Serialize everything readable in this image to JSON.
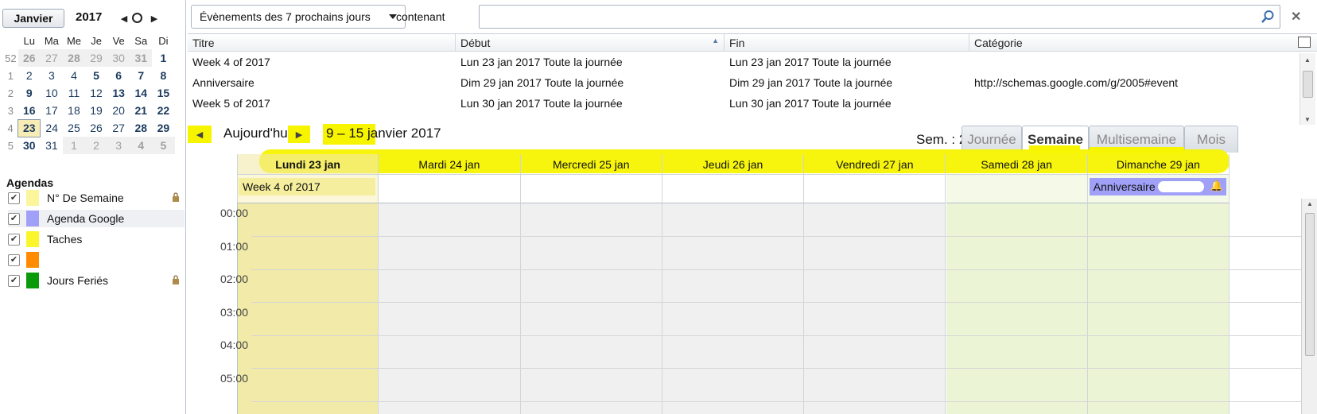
{
  "minical": {
    "month": "Janvier",
    "year": "2017",
    "weekday_headers": [
      "Lu",
      "Ma",
      "Me",
      "Je",
      "Ve",
      "Sa",
      "Di"
    ],
    "weeks": [
      {
        "wk": "52",
        "days": [
          "26",
          "27",
          "28",
          "29",
          "30",
          "31",
          "1"
        ]
      },
      {
        "wk": "1",
        "days": [
          "2",
          "3",
          "4",
          "5",
          "6",
          "7",
          "8"
        ]
      },
      {
        "wk": "2",
        "days": [
          "9",
          "10",
          "11",
          "12",
          "13",
          "14",
          "15"
        ]
      },
      {
        "wk": "3",
        "days": [
          "16",
          "17",
          "18",
          "19",
          "20",
          "21",
          "22"
        ]
      },
      {
        "wk": "4",
        "days": [
          "23",
          "24",
          "25",
          "26",
          "27",
          "28",
          "29"
        ]
      },
      {
        "wk": "5",
        "days": [
          "30",
          "31",
          "1",
          "2",
          "3",
          "4",
          "5"
        ]
      }
    ]
  },
  "agendas": {
    "heading": "Agendas",
    "items": [
      {
        "label": "N° De Semaine",
        "color": "#fbf59c",
        "locked": true
      },
      {
        "label": "Agenda Google",
        "color": "#a0a0f8",
        "locked": false
      },
      {
        "label": "Taches",
        "color": "#fbf52b",
        "locked": false
      },
      {
        "label": "",
        "color": "#ff8c00",
        "locked": false
      },
      {
        "label": "Jours Feriés",
        "color": "#0a9a0a",
        "locked": true
      }
    ]
  },
  "filter": {
    "select": "Évènements des 7 prochains jours",
    "containing_label": "contenant",
    "search_value": ""
  },
  "events_table": {
    "headers": [
      "Titre",
      "Début",
      "Fin",
      "Catégorie"
    ],
    "rows": [
      [
        "Week 4 of 2017",
        "Lun 23 jan 2017 Toute la journée",
        "Lun 23 jan 2017 Toute la journée",
        ""
      ],
      [
        "Anniversaire",
        "Dim 29 jan 2017 Toute la journée",
        "Dim 29 jan 2017 Toute la journée",
        "http://schemas.google.com/g/2005#event"
      ],
      [
        "Week 5 of 2017",
        "Lun 30 jan 2017 Toute la journée",
        "Lun 30 jan 2017 Toute la journée",
        ""
      ]
    ]
  },
  "nav": {
    "today": "Aujourd'hui",
    "range": "9 – 15 janvier 2017",
    "week_no": "Sem. : 2",
    "tabs": [
      "Journée",
      "Semaine",
      "Multisemaine",
      "Mois"
    ],
    "selected_tab": "Semaine"
  },
  "week": {
    "days": [
      "Lundi 23 jan",
      "Mardi 24 jan",
      "Mercredi 25 jan",
      "Jeudi 26 jan",
      "Vendredi 27 jan",
      "Samedi 28 jan",
      "Dimanche 29 jan"
    ],
    "allday_events": [
      {
        "day": 0,
        "title": "Week 4 of 2017"
      },
      {
        "day": 6,
        "title": "Anniversaire"
      }
    ],
    "hours": [
      "00:00",
      "01:00",
      "02:00",
      "03:00",
      "04:00",
      "05:00"
    ]
  },
  "colors": {
    "highlight": "#f7f400",
    "today_col": "#f1eaa9",
    "weekend_col": "#ebf5d6",
    "google_event": "#a0a0f8"
  }
}
